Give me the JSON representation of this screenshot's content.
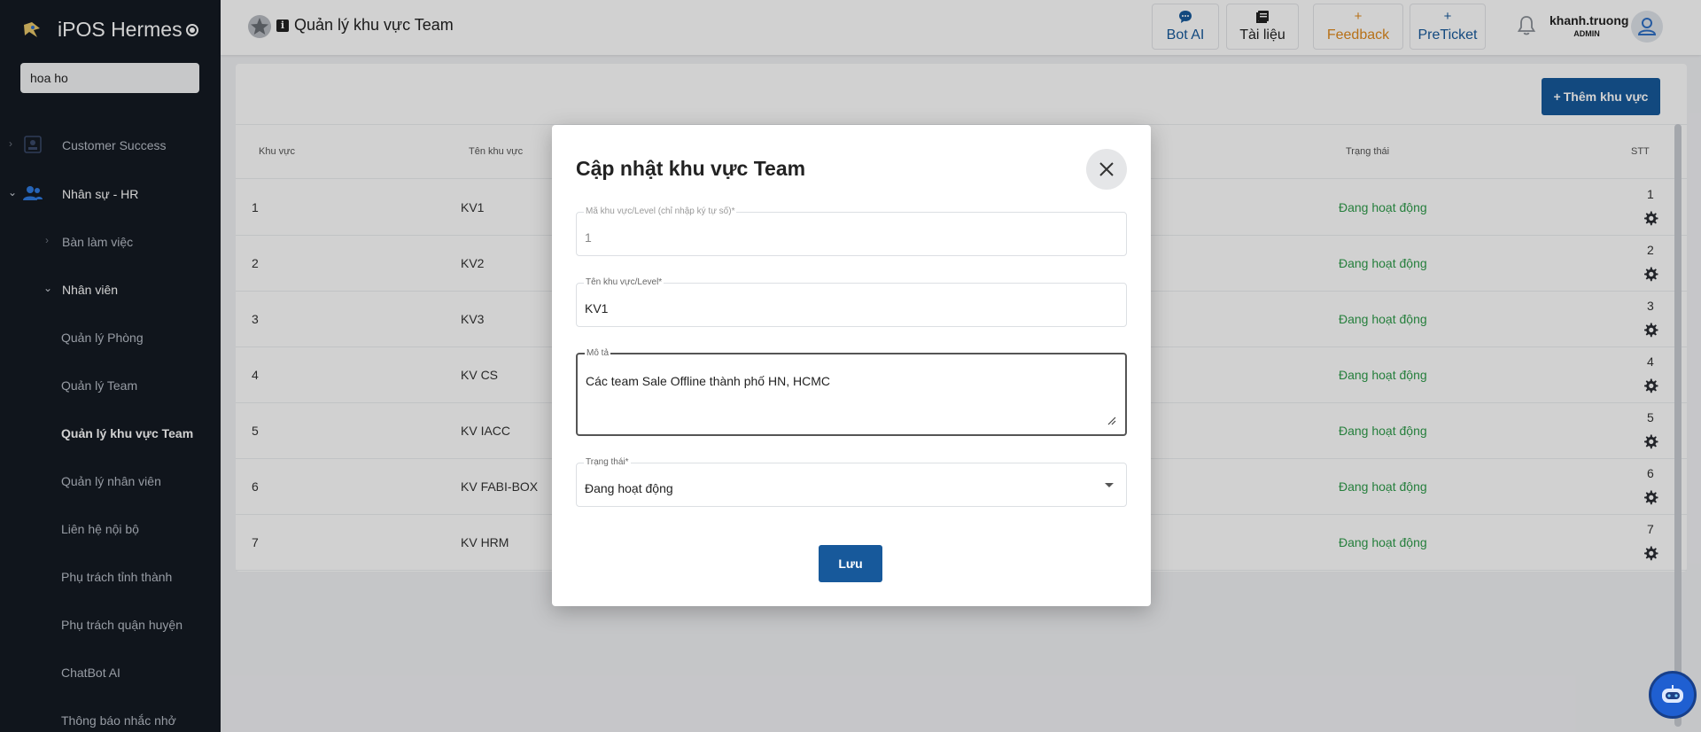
{
  "brand": {
    "title": "iPOS Hermes"
  },
  "sidebar": {
    "search_value": "hoa ho",
    "items": [
      {
        "label": "Customer Success"
      },
      {
        "label": "Nhân sự - HR"
      },
      {
        "label": "Bàn làm việc"
      },
      {
        "label": "Nhân viên"
      },
      {
        "label": "Quản lý Phòng"
      },
      {
        "label": "Quản lý Team"
      },
      {
        "label": "Quản lý khu vực Team"
      },
      {
        "label": "Quản lý nhân viên"
      },
      {
        "label": "Liên hệ nội bộ"
      },
      {
        "label": "Phụ trách tỉnh thành"
      },
      {
        "label": "Phụ trách quận huyện"
      },
      {
        "label": "ChatBot AI"
      },
      {
        "label": "Thông báo nhắc nhở"
      }
    ]
  },
  "header": {
    "title": "Quản lý khu vực Team",
    "buttons": [
      {
        "label": "Bot AI",
        "color": "#17599b"
      },
      {
        "label": "Tài liệu",
        "color": "#222222"
      },
      {
        "label": "Feedback",
        "color": "#e08a1e"
      },
      {
        "label": "PreTicket",
        "color": "#17599b"
      }
    ],
    "user": {
      "name": "khanh.truong",
      "role": "ADMIN"
    }
  },
  "main": {
    "add_button": "Thêm khu vực",
    "columns": [
      "Khu vực",
      "Tên khu vực",
      "Trạng thái",
      "STT"
    ],
    "rows": [
      {
        "code": "1",
        "name": "KV1",
        "status": "Đang hoạt động",
        "stt": "1"
      },
      {
        "code": "2",
        "name": "KV2",
        "status": "Đang hoạt động",
        "stt": "2"
      },
      {
        "code": "3",
        "name": "KV3",
        "status": "Đang hoạt động",
        "stt": "3"
      },
      {
        "code": "4",
        "name": "KV CS",
        "status": "Đang hoạt động",
        "stt": "4"
      },
      {
        "code": "5",
        "name": "KV IACC",
        "status": "Đang hoạt động",
        "stt": "5"
      },
      {
        "code": "6",
        "name": "KV FABI-BOX",
        "status": "Đang hoạt động",
        "stt": "6"
      },
      {
        "code": "7",
        "name": "KV HRM",
        "status": "Đang hoạt động",
        "stt": "7"
      }
    ]
  },
  "modal": {
    "title": "Cập nhật khu vực Team",
    "fields": {
      "code": {
        "label": "Mã khu vực/Level (chỉ nhập ký tự số)*",
        "value": "1"
      },
      "name": {
        "label": "Tên khu vực/Level*",
        "value": "KV1"
      },
      "description": {
        "label": "Mô tả",
        "value": "Các team Sale Offline thành phố HN, HCMC"
      },
      "status": {
        "label": "Trạng thái*",
        "value": "Đang hoạt động"
      }
    },
    "save_label": "Lưu"
  }
}
